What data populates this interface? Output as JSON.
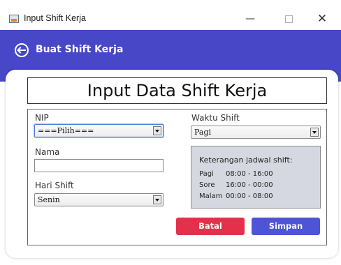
{
  "window": {
    "title": "Input Shift Kerja",
    "min_glyph": "—",
    "close_glyph": "✕"
  },
  "header": {
    "title": "Buat Shift Kerja",
    "back_icon": "arrow-left-circle-icon"
  },
  "form": {
    "title": "Input Data Shift Kerja",
    "nip": {
      "label": "NIP",
      "selected": "===Pilih==="
    },
    "nama": {
      "label": "Nama",
      "value": ""
    },
    "hari_shift": {
      "label": "Hari Shift",
      "selected": "Senin"
    },
    "waktu_shift": {
      "label": "Waktu Shift",
      "selected": "Pagi"
    },
    "info": {
      "title": "Keterangan jadwal shift:",
      "rows": [
        {
          "name": "Pagi",
          "time": "08:00 - 16:00"
        },
        {
          "name": "Sore",
          "time": "16:00 - 00:00"
        },
        {
          "name": "Malam",
          "time": "00:00 - 08:00"
        }
      ]
    },
    "buttons": {
      "batal": "Batal",
      "simpan": "Simpan"
    }
  },
  "colors": {
    "header": "#4747c8",
    "batal": "#e4304a",
    "simpan": "#4d54d6",
    "info_bg": "#d6d8e1"
  }
}
